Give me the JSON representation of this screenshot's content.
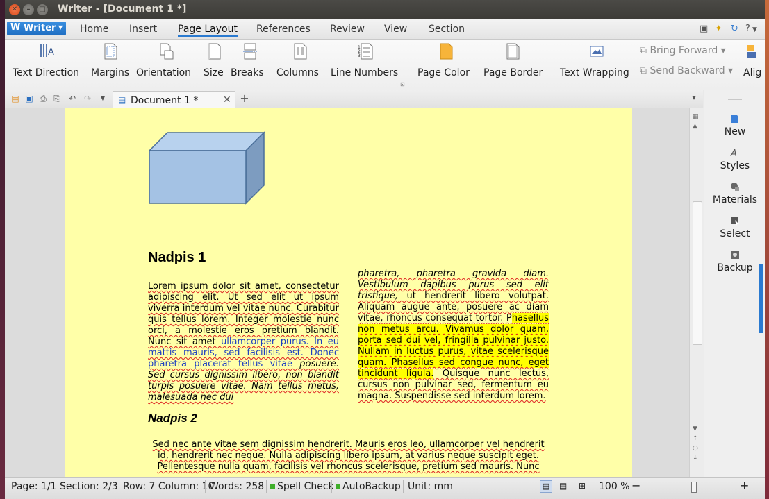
{
  "window": {
    "title": "Writer - [Document 1 *]"
  },
  "app_button": {
    "label": "Writer"
  },
  "menu": {
    "tabs": [
      "Home",
      "Insert",
      "Page Layout",
      "References",
      "Review",
      "View",
      "Section"
    ],
    "active": "Page Layout",
    "help": "?"
  },
  "ribbon": {
    "text_direction": "Text Direction",
    "margins": "Margins",
    "orientation": "Orientation",
    "size": "Size",
    "breaks": "Breaks",
    "columns": "Columns",
    "line_numbers": "Line Numbers",
    "page_color": "Page Color",
    "page_border": "Page Border",
    "text_wrapping": "Text Wrapping",
    "bring_forward": "Bring Forward",
    "send_backward": "Send Backward",
    "align": "Alig"
  },
  "doc_tab": {
    "title": "Document 1 *"
  },
  "side_panel": {
    "items": [
      "New",
      "Styles",
      "Materials",
      "Select",
      "Backup"
    ]
  },
  "document": {
    "heading1": "Nadpis 1",
    "heading2": "Nadpis 2",
    "col1": {
      "plain": "Lorem ipsum dolor sit amet, consectetur adipiscing elit. Ut sed elit ut ipsum viverra interdum vel vitae nunc. Curabitur quis tellus lorem. Integer molestie nunc orci, a molestie eros pretium blandit. Nunc sit amet ",
      "blue": "ullamcorper purus. In eu mattis mauris, sed facilisis est. Donec pharetra placerat tellus vitae ",
      "italic": "posuere. Sed cursus dignissim libero, non blandit turpis posuere vitae. Nam tellus metus, malesuada nec dui"
    },
    "col2": {
      "italic": "pharetra, pharetra gravida diam. Vestibulum dapibus purus sed elit tristique,",
      "plain": " ut hendrerit libero volutpat. Aliquam augue ante, posuere ac diam vitae, rhoncus consequat tortor. P",
      "highlight1": "hasellus non metus arcu. Vivamus dolor quam, porta sed dui vel, fringilla pulvinar justo. Nullam in luctus purus, vitae scelerisque quam. Phasellus sed congue nunc, eget tincidunt ligula.",
      "plain2": " Quisque nunc lectus, cursus non pulvinar sed, fermentum eu magna. Suspendisse sed interdum lorem."
    },
    "para3": "Sed nec ante vitae sem dignissim hendrerit. Mauris eros leo, ullamcorper vel hendrerit id, hendrerit nec neque. Nulla adipiscing libero ipsum, at varius neque suscipit eget. Pellentesque nulla quam, facilisis vel rhoncus scelerisque, pretium sed mauris. Nunc"
  },
  "status": {
    "page": "Page: 1/1 Section: 2/3",
    "rowcol": "Row: 7 Column: 10",
    "words": "Words: 258",
    "spell": "Spell Check",
    "autobackup": "AutoBackup",
    "unit": "Unit: mm",
    "zoom": "100 %",
    "zoom_level": 1.0
  },
  "colors": {
    "accent": "#2a7ad0",
    "page": "#ffffa8",
    "highlight": "#ffff00",
    "link": "#1d3fc0"
  }
}
